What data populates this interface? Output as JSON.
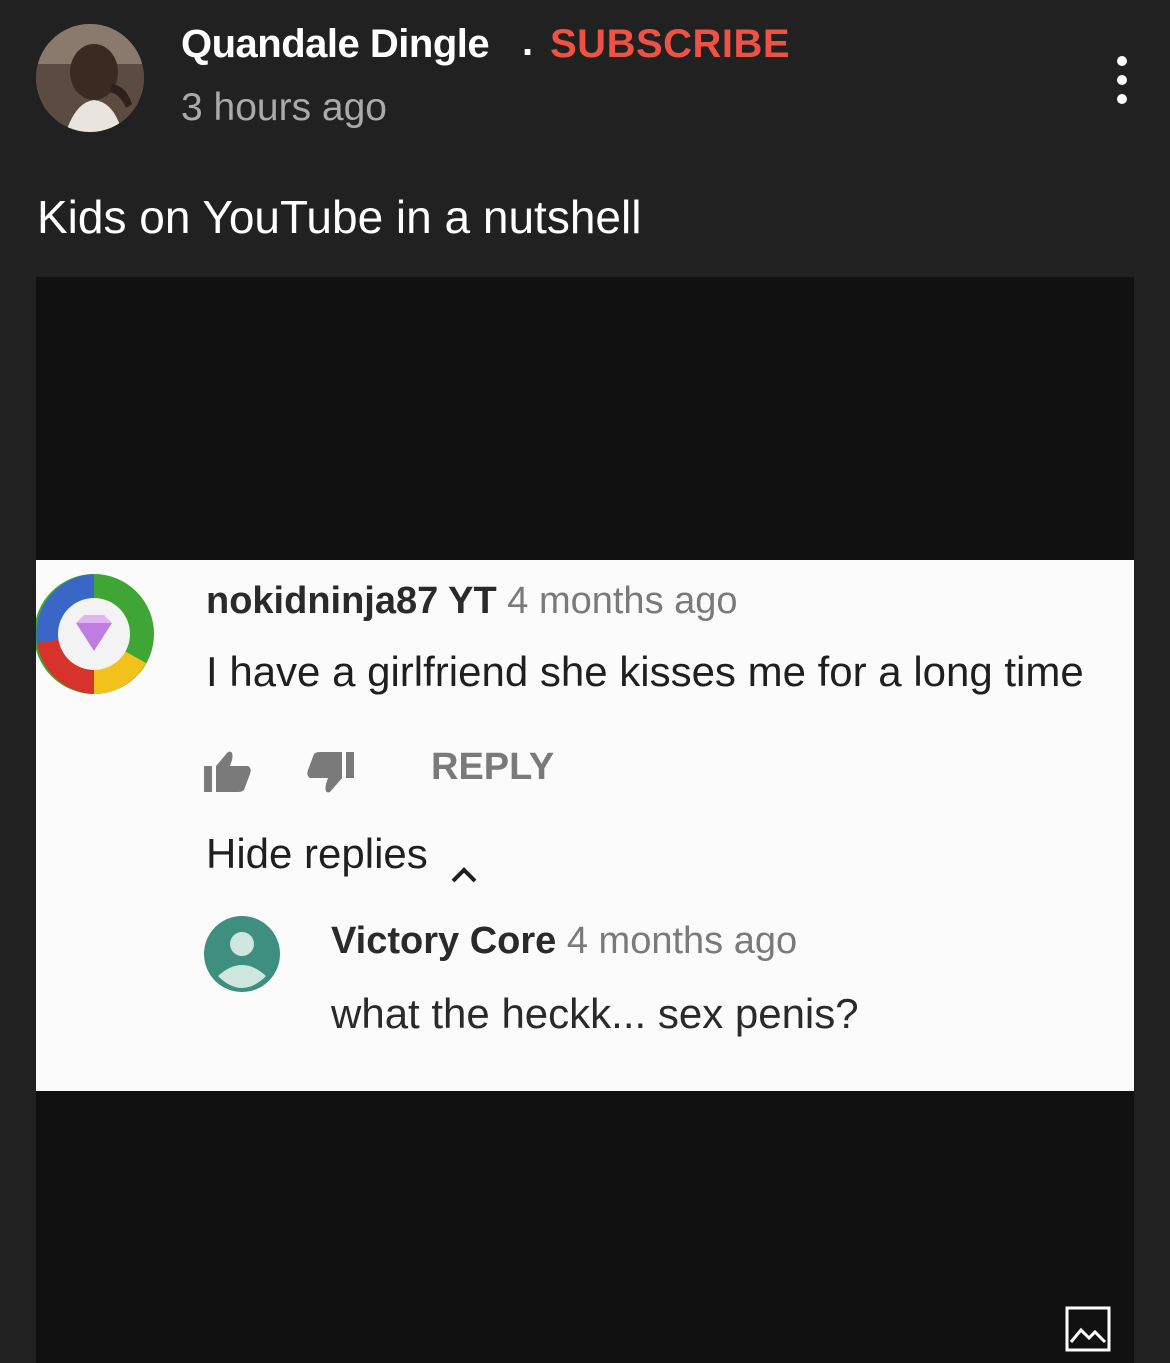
{
  "header": {
    "channel_name": "Quandale Dingle",
    "separator": ".",
    "subscribe_label": "SUBSCRIBE",
    "timestamp": "3 hours ago",
    "more_icon": "vertical-dots-icon"
  },
  "post": {
    "text": "Kids on YouTube in a nutshell"
  },
  "media": {
    "comment": {
      "author": "nokidninja87 YT",
      "time": "4 months ago",
      "text": "I have a girlfriend she kisses me for a long time",
      "reply_label": "REPLY",
      "hide_replies_label": "Hide replies"
    },
    "reply": {
      "author": "Victory Core",
      "time": "4 months ago",
      "text": "what the heckk... sex penis?"
    },
    "image_icon": "image-icon"
  },
  "colors": {
    "background": "#212121",
    "subscribe": "#ee5244",
    "media_background": "#111111",
    "comment_background": "#fbfbfb",
    "reply_avatar": "#3f8f80"
  }
}
